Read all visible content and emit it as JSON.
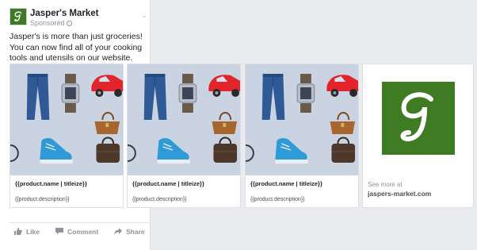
{
  "post": {
    "page_name": "Jasper's Market",
    "sponsored_label": "Sponsored",
    "text": "Jasper's is more than just groceries! You can now find all of your cooking tools and utensils on our website.",
    "logo_letter": "g"
  },
  "carousel": {
    "cards": [
      {
        "name": "{{product.name | titleize}}",
        "description": "{{product.description}}"
      },
      {
        "name": "{{product.name | titleize}}",
        "description": "{{product.description}}"
      },
      {
        "name": "{{product.name | titleize}}",
        "description": "{{product.description}}"
      }
    ],
    "see_more": {
      "label": "See more at",
      "domain": "jaspers-market.com"
    }
  },
  "actions": {
    "like": "Like",
    "comment": "Comment",
    "share": "Share"
  },
  "colors": {
    "brand_green": "#3e7b23",
    "image_bg": "#c9d3e2",
    "page_bg": "#e9ebee"
  },
  "icons": [
    "globe-icon",
    "chevron-down-icon",
    "like-icon",
    "comment-icon",
    "share-icon"
  ]
}
